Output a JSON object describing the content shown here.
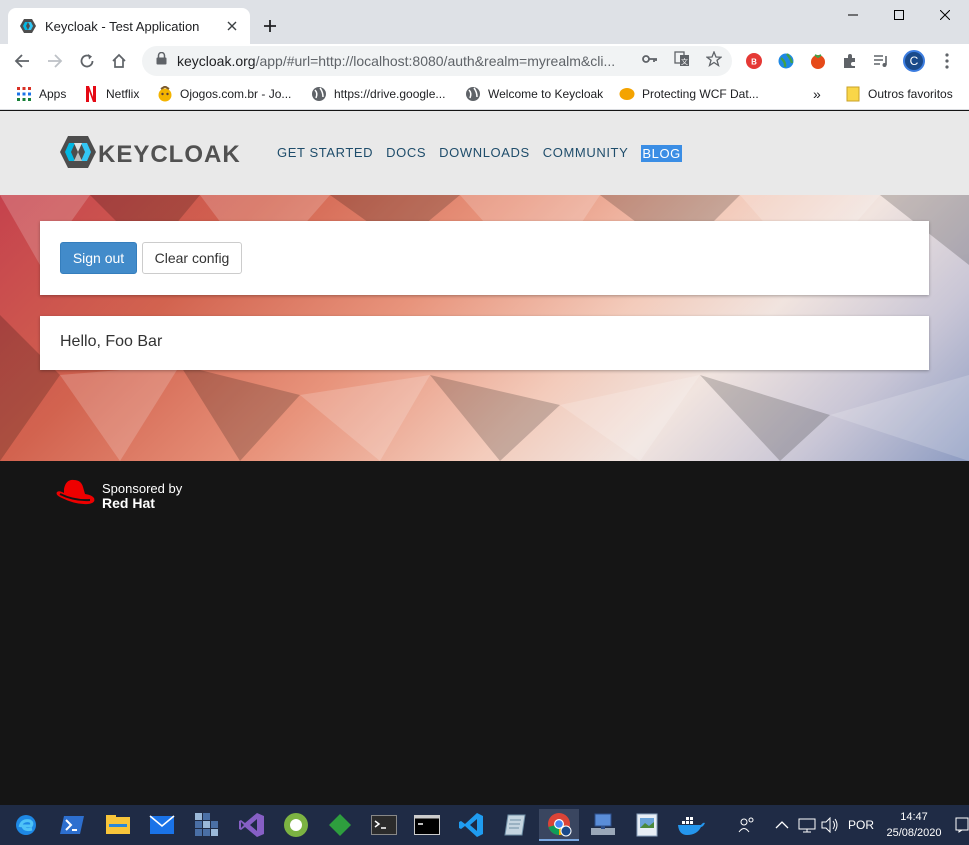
{
  "browser": {
    "tab": {
      "title": "Keycloak - Test Application",
      "favicon": "keycloak-icon"
    },
    "url": {
      "host": "keycloak.org",
      "rest": "/app/#url=http://localhost:8080/auth&realm=myrealm&cli..."
    },
    "profile_initial": "C",
    "bookmarks": [
      {
        "label": "Apps",
        "icon": "apps-grid-icon"
      },
      {
        "label": "Netflix",
        "icon": "netflix-icon"
      },
      {
        "label": "Ojogos.com.br - Jo...",
        "icon": "ojogos-icon"
      },
      {
        "label": "https://drive.google...",
        "icon": "globe-icon"
      },
      {
        "label": "Welcome to Keycloak",
        "icon": "globe-icon"
      },
      {
        "label": "Protecting WCF Dat...",
        "icon": "orange-icon"
      }
    ],
    "bookmarks_overflow": "»",
    "other_bookmarks": "Outros favoritos"
  },
  "site": {
    "logo_text": "KEYCLOAK",
    "nav": [
      "GET STARTED",
      "DOCS",
      "DOWNLOADS",
      "COMMUNITY",
      "BLOG"
    ],
    "active_nav": "BLOG",
    "sign_out_label": "Sign out",
    "clear_config_label": "Clear config",
    "greeting": "Hello, Foo Bar",
    "sponsor_by": "Sponsored by",
    "sponsor_name": "Red Hat"
  },
  "taskbar": {
    "language": "POR",
    "time": "14:47",
    "date": "25/08/2020"
  },
  "colors": {
    "primary_button": "#428bca",
    "active_nav_bg": "#3b8ee5",
    "nav_text": "#1f4d6b",
    "footer_bg": "#151515",
    "taskbar_bg": "#1f2b45"
  }
}
